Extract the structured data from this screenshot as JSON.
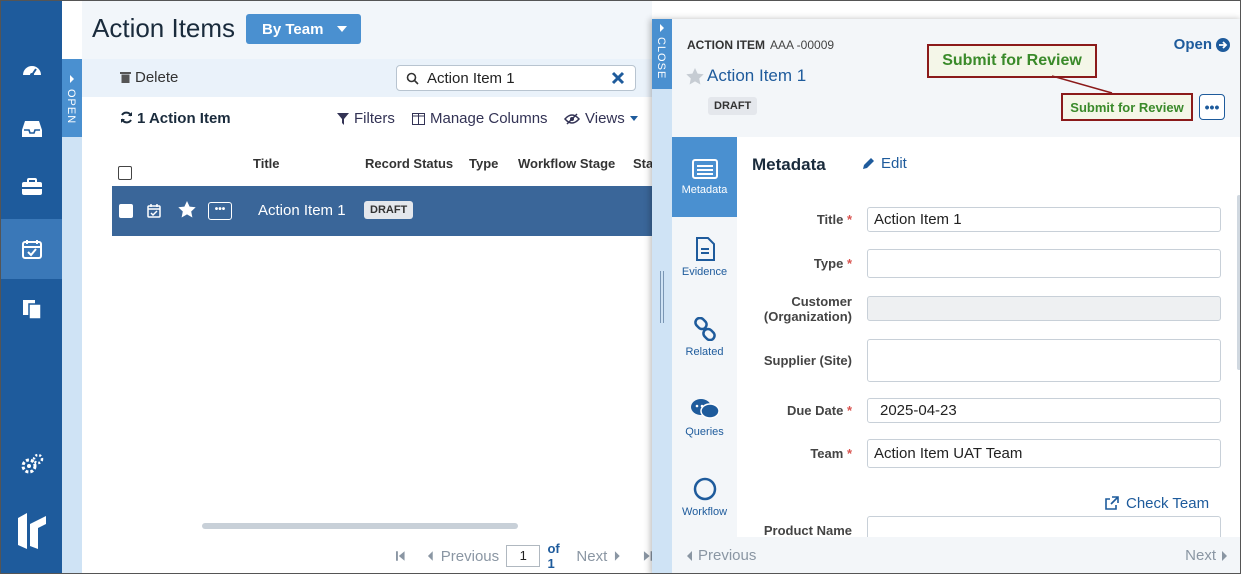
{
  "rail": {
    "items": [
      "dashboard-icon",
      "inbox-icon",
      "briefcase-icon",
      "calendar-check-icon",
      "documents-icon"
    ],
    "bottom": [
      "settings-icon",
      "logo-icon"
    ]
  },
  "side_tab": {
    "open_label": "OPEN"
  },
  "header": {
    "title": "Action Items",
    "view_button": "By Team"
  },
  "toolbar": {
    "delete_label": "Delete",
    "search_value": "Action Item 1"
  },
  "list": {
    "count_label": "1 Action Item",
    "filters_label": "Filters",
    "manage_columns_label": "Manage Columns",
    "views_label": "Views",
    "columns": [
      "Title",
      "Record Status",
      "Type",
      "Workflow Stage",
      "Sta"
    ],
    "rows": [
      {
        "title": "Action Item 1",
        "status": "DRAFT"
      }
    ]
  },
  "pagination": {
    "previous": "Previous",
    "page": "1",
    "of_label": "of 1",
    "next": "Next"
  },
  "panel": {
    "close_label": "CLOSE",
    "type_label": "ACTION ITEM",
    "record_id": "AAA -00009",
    "open_label": "Open",
    "title": "Action Item 1",
    "status": "DRAFT",
    "submit_callout": "Submit for Review",
    "submit_button": "Submit for Review",
    "more_label": "•••",
    "tabs": [
      "Metadata",
      "Evidence",
      "Related",
      "Queries",
      "Workflow"
    ],
    "section_title": "Metadata",
    "edit_label": "Edit",
    "fields": {
      "title": {
        "label": "Title",
        "value": "Action Item 1"
      },
      "type": {
        "label": "Type",
        "value": ""
      },
      "customer": {
        "label": "Customer (Organization)",
        "value": ""
      },
      "supplier": {
        "label": "Supplier (Site)",
        "value": ""
      },
      "due_date": {
        "label": "Due Date",
        "value": "2025-04-23"
      },
      "team": {
        "label": "Team",
        "value": "Action Item UAT Team"
      },
      "product": {
        "label": "Product Name",
        "value": ""
      }
    },
    "check_team_label": "Check Team",
    "footer": {
      "previous": "Previous",
      "next": "Next"
    }
  },
  "colors": {
    "rail": "#1e5b9c",
    "accent": "#4a90d0",
    "selected_row": "#3a6699",
    "callout_border": "#8b1a1a",
    "callout_text": "#3a8a2a"
  }
}
